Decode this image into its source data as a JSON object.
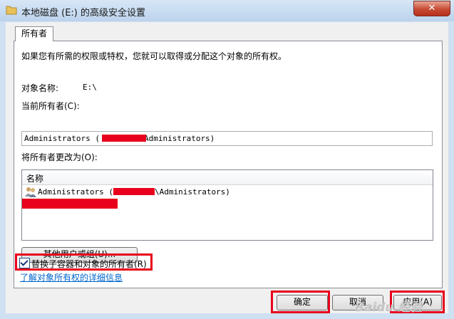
{
  "window": {
    "title": "本地磁盘 (E:) 的高级安全设置",
    "close_label": "✕"
  },
  "tabs": [
    {
      "label": "所有者"
    }
  ],
  "panel": {
    "instruction": "如果您有所需的权限或特权，您就可以取得或分配这个对象的所有权。",
    "object_name_label": "对象名称:",
    "object_name_value": "E:\\",
    "current_owner_label": "当前所有者(C):",
    "current_owner_value_prefix": "Administrators (",
    "current_owner_value_suffix": "Administrators)",
    "change_owner_label": "将所有者更改为(O):",
    "list": {
      "column_header": "名称",
      "items": [
        {
          "prefix": "Administrators (",
          "suffix": "\\Administrators)"
        }
      ]
    },
    "other_users_button": "其他用户或组(U)...",
    "replace_owner_checkbox": {
      "label": "替换子容器和对象的所有者(R)",
      "checked": true
    },
    "learn_more_link": "了解对象所有权的详细信息"
  },
  "buttons": {
    "ok": "确定",
    "cancel": "取消",
    "apply": "应用(A)"
  },
  "watermark": "Baidu 经验",
  "colors": {
    "highlight_red": "#e8001c",
    "link_blue": "#0066cc",
    "title_bar": "#bcd3ec"
  }
}
